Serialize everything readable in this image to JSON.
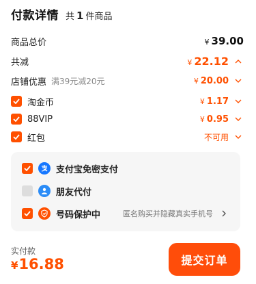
{
  "header": {
    "title": "付款详情",
    "count_prefix": "共",
    "count": "1",
    "count_suffix": "件商品"
  },
  "rows": {
    "total": {
      "label": "商品总价",
      "currency": "¥",
      "value": "39.00"
    },
    "discount": {
      "label": "共减",
      "currency": "¥",
      "value": "22.12"
    },
    "shop": {
      "label": "店铺优惠",
      "sub": "满39元减20元",
      "currency": "¥",
      "value": "20.00"
    },
    "taojinbi": {
      "label": "淘金币",
      "currency": "¥",
      "value": "1.17",
      "checked": true
    },
    "vip": {
      "label": "88VIP",
      "currency": "¥",
      "value": "0.95",
      "checked": true
    },
    "hongbao": {
      "label": "红包",
      "value": "不可用",
      "checked": true
    }
  },
  "payment_panel": {
    "alipay": {
      "label": "支付宝免密支付",
      "checked": true
    },
    "friend": {
      "label": "朋友代付",
      "checked": false
    },
    "privacy": {
      "label": "号码保护中",
      "note": "匿名购买并隐藏真实手机号",
      "checked": true
    }
  },
  "footer": {
    "paid_label": "实付款",
    "currency": "¥",
    "paid_value": "16.88",
    "submit_label": "提交订单"
  },
  "colors": {
    "accent": "#ff5000",
    "alipay_blue": "#1677ff",
    "friend_blue": "#2b8cf7",
    "panel_bg": "#f6f6f6"
  }
}
